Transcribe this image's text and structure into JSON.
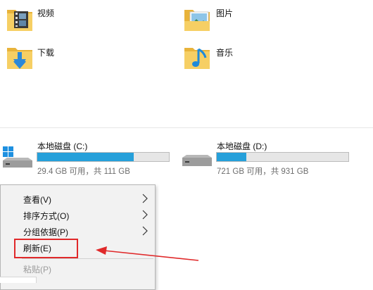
{
  "folders": [
    {
      "label": "视频",
      "icon": "video-folder-icon"
    },
    {
      "label": "图片",
      "icon": "pictures-folder-icon"
    },
    {
      "label": "下载",
      "icon": "downloads-folder-icon"
    },
    {
      "label": "音乐",
      "icon": "music-folder-icon"
    }
  ],
  "drives": [
    {
      "name": "本地磁盘 (C:)",
      "space": "29.4 GB 可用，共 111 GB",
      "used_fraction": 0.735,
      "icon": "windows-drive-icon"
    },
    {
      "name": "本地磁盘 (D:)",
      "space": "721 GB 可用，共 931 GB",
      "used_fraction": 0.226,
      "icon": "hard-drive-icon"
    }
  ],
  "context_menu": {
    "items": [
      {
        "label": "查看(V)",
        "has_submenu": true,
        "enabled": true
      },
      {
        "label": "排序方式(O)",
        "has_submenu": true,
        "enabled": true
      },
      {
        "label": "分组依据(P)",
        "has_submenu": true,
        "enabled": true
      },
      {
        "label": "刷新(E)",
        "has_submenu": false,
        "enabled": true
      },
      {
        "label": "粘贴(P)",
        "has_submenu": false,
        "enabled": false
      }
    ]
  },
  "colors": {
    "progress_fill": "#26a0da",
    "annotation_red": "#e0292a",
    "folder_yellow": "#f3c24a"
  }
}
